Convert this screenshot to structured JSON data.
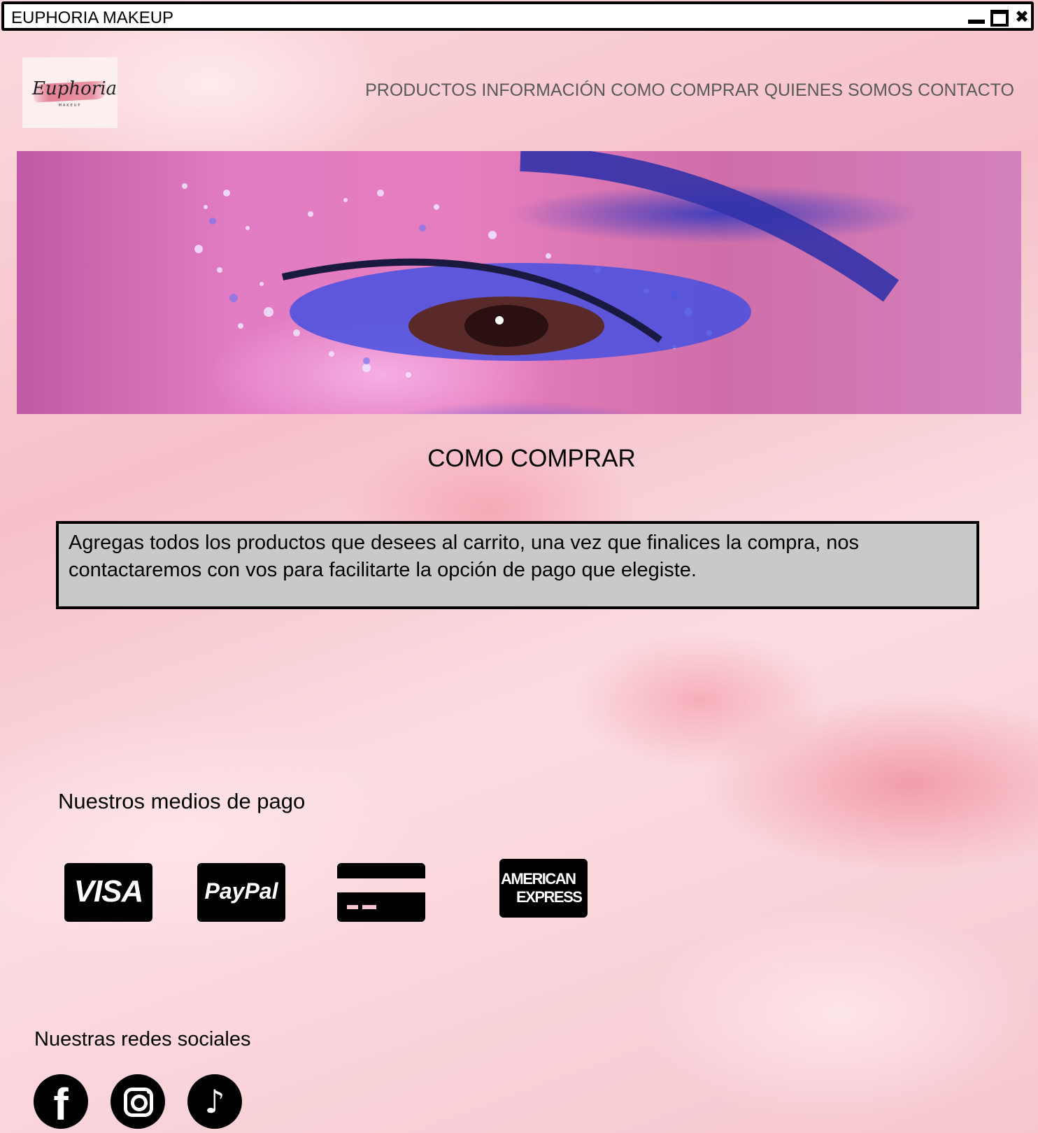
{
  "window": {
    "title": "EUPHORIA MAKEUP",
    "controls": {
      "minimize_icon": "minimize-icon",
      "maximize_icon": "maximize-icon",
      "close_icon": "close-icon",
      "close_glyph": "✖"
    }
  },
  "logo": {
    "script": "Euphoria",
    "sub": "MAKEUP"
  },
  "nav": {
    "items": [
      "PRODUCTOS",
      "INFORMACIÓN",
      "COMO COMPRAR",
      "QUIENES SOMOS",
      "CONTACTO"
    ]
  },
  "main": {
    "title": "COMO COMPRAR",
    "info_text": "Agregas todos los productos que desees al carrito, una vez que finalices la compra, nos contactaremos con vos para facilitarte la opción de pago que elegiste."
  },
  "payments": {
    "heading": "Nuestros medios de pago",
    "methods": {
      "visa": "VISA",
      "paypal": "PayPal",
      "generic_icon": "credit-card-icon",
      "amex_line1": "AMERICAN",
      "amex_line2": "EXPRESS"
    }
  },
  "social": {
    "heading": "Nuestras redes sociales",
    "facebook_glyph": "f",
    "tiktok_glyph": "♪"
  },
  "colors": {
    "background": "#f6c9d0",
    "info_box": "#c9c9c9",
    "nav_text": "#595959"
  }
}
